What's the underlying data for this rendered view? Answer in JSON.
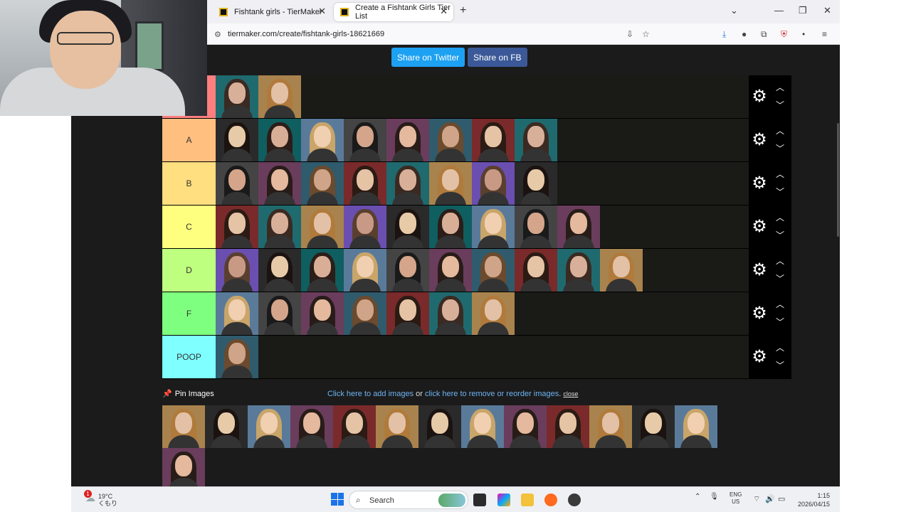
{
  "browser": {
    "tabs": [
      {
        "title": "Fishtank girls - TierMaker",
        "active": false
      },
      {
        "title": "Create a Fishtank Girls Tier List",
        "active": true
      }
    ],
    "new_tab": "+",
    "url": "tiermaker.com/create/fishtank-girls-18621669",
    "window_controls": {
      "minimize": "—",
      "restore": "❐",
      "close": "✕"
    }
  },
  "share": {
    "twitter": "Share on Twitter",
    "fb": "Share on FB"
  },
  "tiers": [
    {
      "label": "",
      "color": "#ff7f7f",
      "count": 2
    },
    {
      "label": "A",
      "color": "#ffbf7f",
      "count": 8
    },
    {
      "label": "B",
      "color": "#ffdf7f",
      "count": 8
    },
    {
      "label": "C",
      "color": "#ffff7f",
      "count": 9
    },
    {
      "label": "D",
      "color": "#bfff7f",
      "count": 10
    },
    {
      "label": "F",
      "color": "#7fff7f",
      "count": 7
    },
    {
      "label": "POOP",
      "color": "#7fffff",
      "count": 1
    }
  ],
  "pin": {
    "label": "Pin Images"
  },
  "add_links": {
    "add": "Click here to add images",
    "or": " or ",
    "reorder": "click here to remove or reorder images",
    "period": ".",
    "close": "close"
  },
  "pool_count": 14,
  "taskbar": {
    "weather_temp": "19°C",
    "weather_desc": "くもり",
    "notifications": "1",
    "search": "Search",
    "lang_top": "ENG",
    "lang_bottom": "US",
    "time": "1:15",
    "date": "2026/04/15"
  }
}
